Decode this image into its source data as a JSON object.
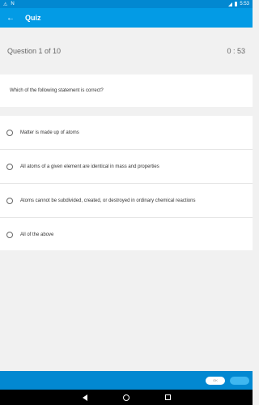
{
  "status_bar": {
    "time": "5:53",
    "left_icons": [
      "alert-icon",
      "n-icon"
    ]
  },
  "app_bar": {
    "title": "Quiz"
  },
  "header": {
    "counter": "Question 1 of  10",
    "timer": "0 : 53"
  },
  "question": {
    "text": "Which of the following statement is correct?"
  },
  "options": [
    {
      "label": "Matter is made up of atoms"
    },
    {
      "label": "All atoms of a given element are identical in mass and properties"
    },
    {
      "label": "Atoms cannot be subdivided, created, or destroyed in ordinary chemical reactions"
    },
    {
      "label": "All of the above"
    }
  ],
  "bottom_bar": {
    "ok_label": "OK"
  },
  "colors": {
    "primary": "#039be5",
    "primary_dark": "#0288d1"
  }
}
